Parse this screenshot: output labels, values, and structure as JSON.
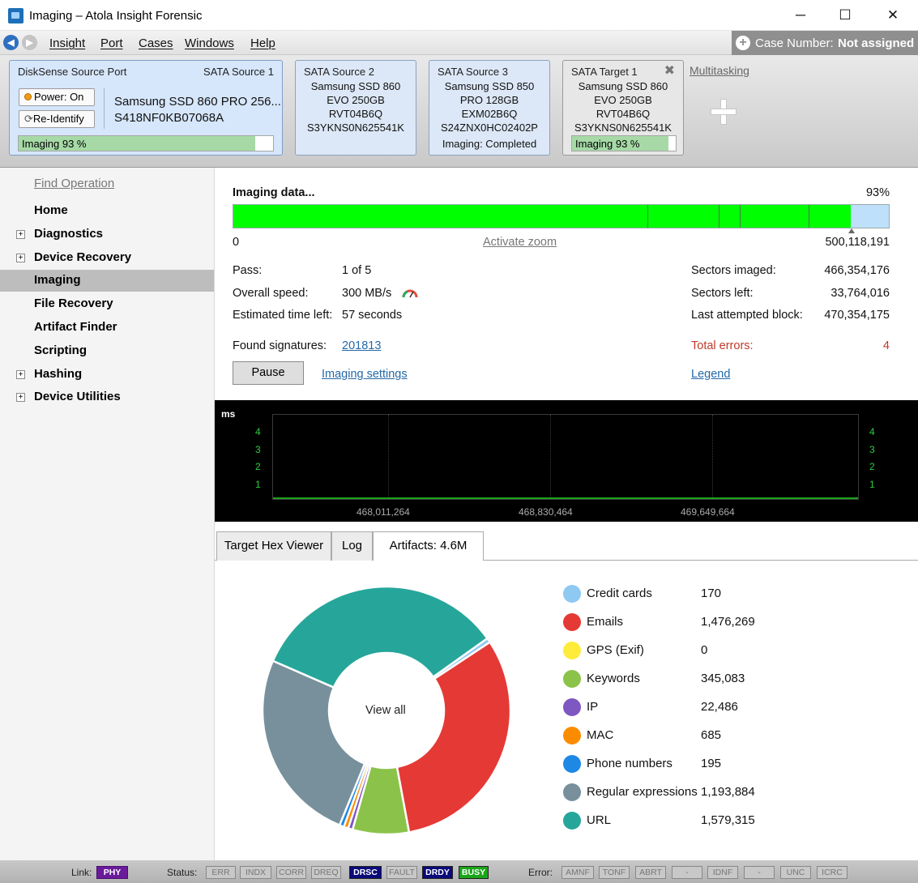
{
  "window": {
    "title": "Imaging – Atola Insight Forensic",
    "minimize": "─",
    "maximize": "☐",
    "close": "✕"
  },
  "menu": {
    "items": [
      "Insight",
      "Port",
      "Cases",
      "Windows",
      "Help"
    ],
    "case_label": "Case Number:",
    "case_value": "Not assigned"
  },
  "ports": {
    "main": {
      "name": "DiskSense Source Port",
      "port": "SATA Source 1",
      "power": "Power: On",
      "reidentify": "Re-Identify",
      "model": "Samsung SSD 860 PRO 256...",
      "serial": "S418NF0KB07068A",
      "progress_text": "Imaging 93 %",
      "progress": 0.93
    },
    "cards": [
      {
        "title": "SATA Source 2",
        "lines": [
          "Samsung SSD 860",
          "EVO 250GB",
          "RVT04B6Q",
          "S3YKNS0N625541K"
        ]
      },
      {
        "title": "SATA Source 3",
        "lines": [
          "Samsung SSD 850",
          "PRO 128GB",
          "EXM02B6Q",
          "S24ZNX0HC02402P",
          "Imaging: Completed"
        ]
      },
      {
        "title": "SATA Target 1",
        "lines": [
          "Samsung SSD 860",
          "EVO 250GB",
          "RVT04B6Q",
          "S3YKNS0N625541K"
        ],
        "progress_text": "Imaging 93 %",
        "progress": 0.93
      }
    ],
    "multitasking": "Multitasking"
  },
  "sidebar": {
    "find": "Find Operation",
    "items": [
      {
        "label": "Home",
        "expandable": false
      },
      {
        "label": "Diagnostics",
        "expandable": true
      },
      {
        "label": "Device Recovery",
        "expandable": true
      },
      {
        "label": "Imaging",
        "expandable": false,
        "selected": true
      },
      {
        "label": "File Recovery",
        "expandable": false
      },
      {
        "label": "Artifact Finder",
        "expandable": false
      },
      {
        "label": "Scripting",
        "expandable": false
      },
      {
        "label": "Hashing",
        "expandable": true
      },
      {
        "label": "Device Utilities",
        "expandable": true
      }
    ]
  },
  "imaging": {
    "status": "Imaging data...",
    "percent": "93%",
    "progress": 0.93,
    "range_start": "0",
    "range_end": "500,118,191",
    "zoom": "Activate zoom",
    "pass_label": "Pass:",
    "pass_value": "1 of 5",
    "speed_label": "Overall speed:",
    "speed_value": "300 MB/s",
    "eta_label": "Estimated time left:",
    "eta_value": "57 seconds",
    "signatures_label": "Found signatures:",
    "signatures_value": "201813",
    "sectors_imaged_label": "Sectors imaged:",
    "sectors_imaged_value": "466,354,176",
    "sectors_left_label": "Sectors left:",
    "sectors_left_value": "33,764,016",
    "last_block_label": "Last attempted block:",
    "last_block_value": "470,354,175",
    "errors_label": "Total errors:",
    "errors_value": "4",
    "pause": "Pause",
    "settings": "Imaging settings",
    "legend": "Legend",
    "bar_color": "#00ff00",
    "error_color": "#c0392b"
  },
  "graph": {
    "unit": "ms",
    "y_ticks": [
      "1",
      "2",
      "3",
      "4"
    ],
    "x_ticks": [
      "468,011,264",
      "468,830,464",
      "469,649,664"
    ]
  },
  "tabs": [
    "Target Hex Viewer",
    "Log",
    "Artifacts: 4.6M"
  ],
  "artifacts": {
    "center": "View all",
    "items": [
      {
        "label": "Credit cards",
        "value": "170",
        "count": 170,
        "color": "#8ec9f2"
      },
      {
        "label": "Emails",
        "value": "1,476,269",
        "count": 1476269,
        "color": "#e53935"
      },
      {
        "label": "GPS (Exif)",
        "value": "0",
        "count": 0,
        "color": "#ffeb3b"
      },
      {
        "label": "Keywords",
        "value": "345,083",
        "count": 345083,
        "color": "#8bc34a"
      },
      {
        "label": "IP",
        "value": "22,486",
        "count": 22486,
        "color": "#7e57c2"
      },
      {
        "label": "MAC",
        "value": "685",
        "count": 685,
        "color": "#fb8c00"
      },
      {
        "label": "Phone numbers",
        "value": "195",
        "count": 195,
        "color": "#1e88e5"
      },
      {
        "label": "Regular expressions",
        "value": "1,193,884",
        "count": 1193884,
        "color": "#78909c"
      },
      {
        "label": "URL",
        "value": "1,579,315",
        "count": 1579315,
        "color": "#26a69a"
      }
    ]
  },
  "statusbar": {
    "link_label": "Link:",
    "link": "PHY",
    "status_label": "Status:",
    "status": [
      {
        "t": "ERR",
        "on": false
      },
      {
        "t": "INDX",
        "on": false
      },
      {
        "t": "CORR",
        "on": false
      },
      {
        "t": "DREQ",
        "on": false
      },
      {
        "t": "DRSC",
        "on": true,
        "c": "#0a0a7a"
      },
      {
        "t": "FAULT",
        "on": false
      },
      {
        "t": "DRDY",
        "on": true,
        "c": "#0a0a7a"
      },
      {
        "t": "BUSY",
        "on": true,
        "c": "#1aa51a"
      }
    ],
    "error_label": "Error:",
    "errors": [
      "AMNF",
      "TONF",
      "ABRT",
      "-",
      "IDNF",
      "-",
      "UNC",
      "ICRC"
    ]
  }
}
